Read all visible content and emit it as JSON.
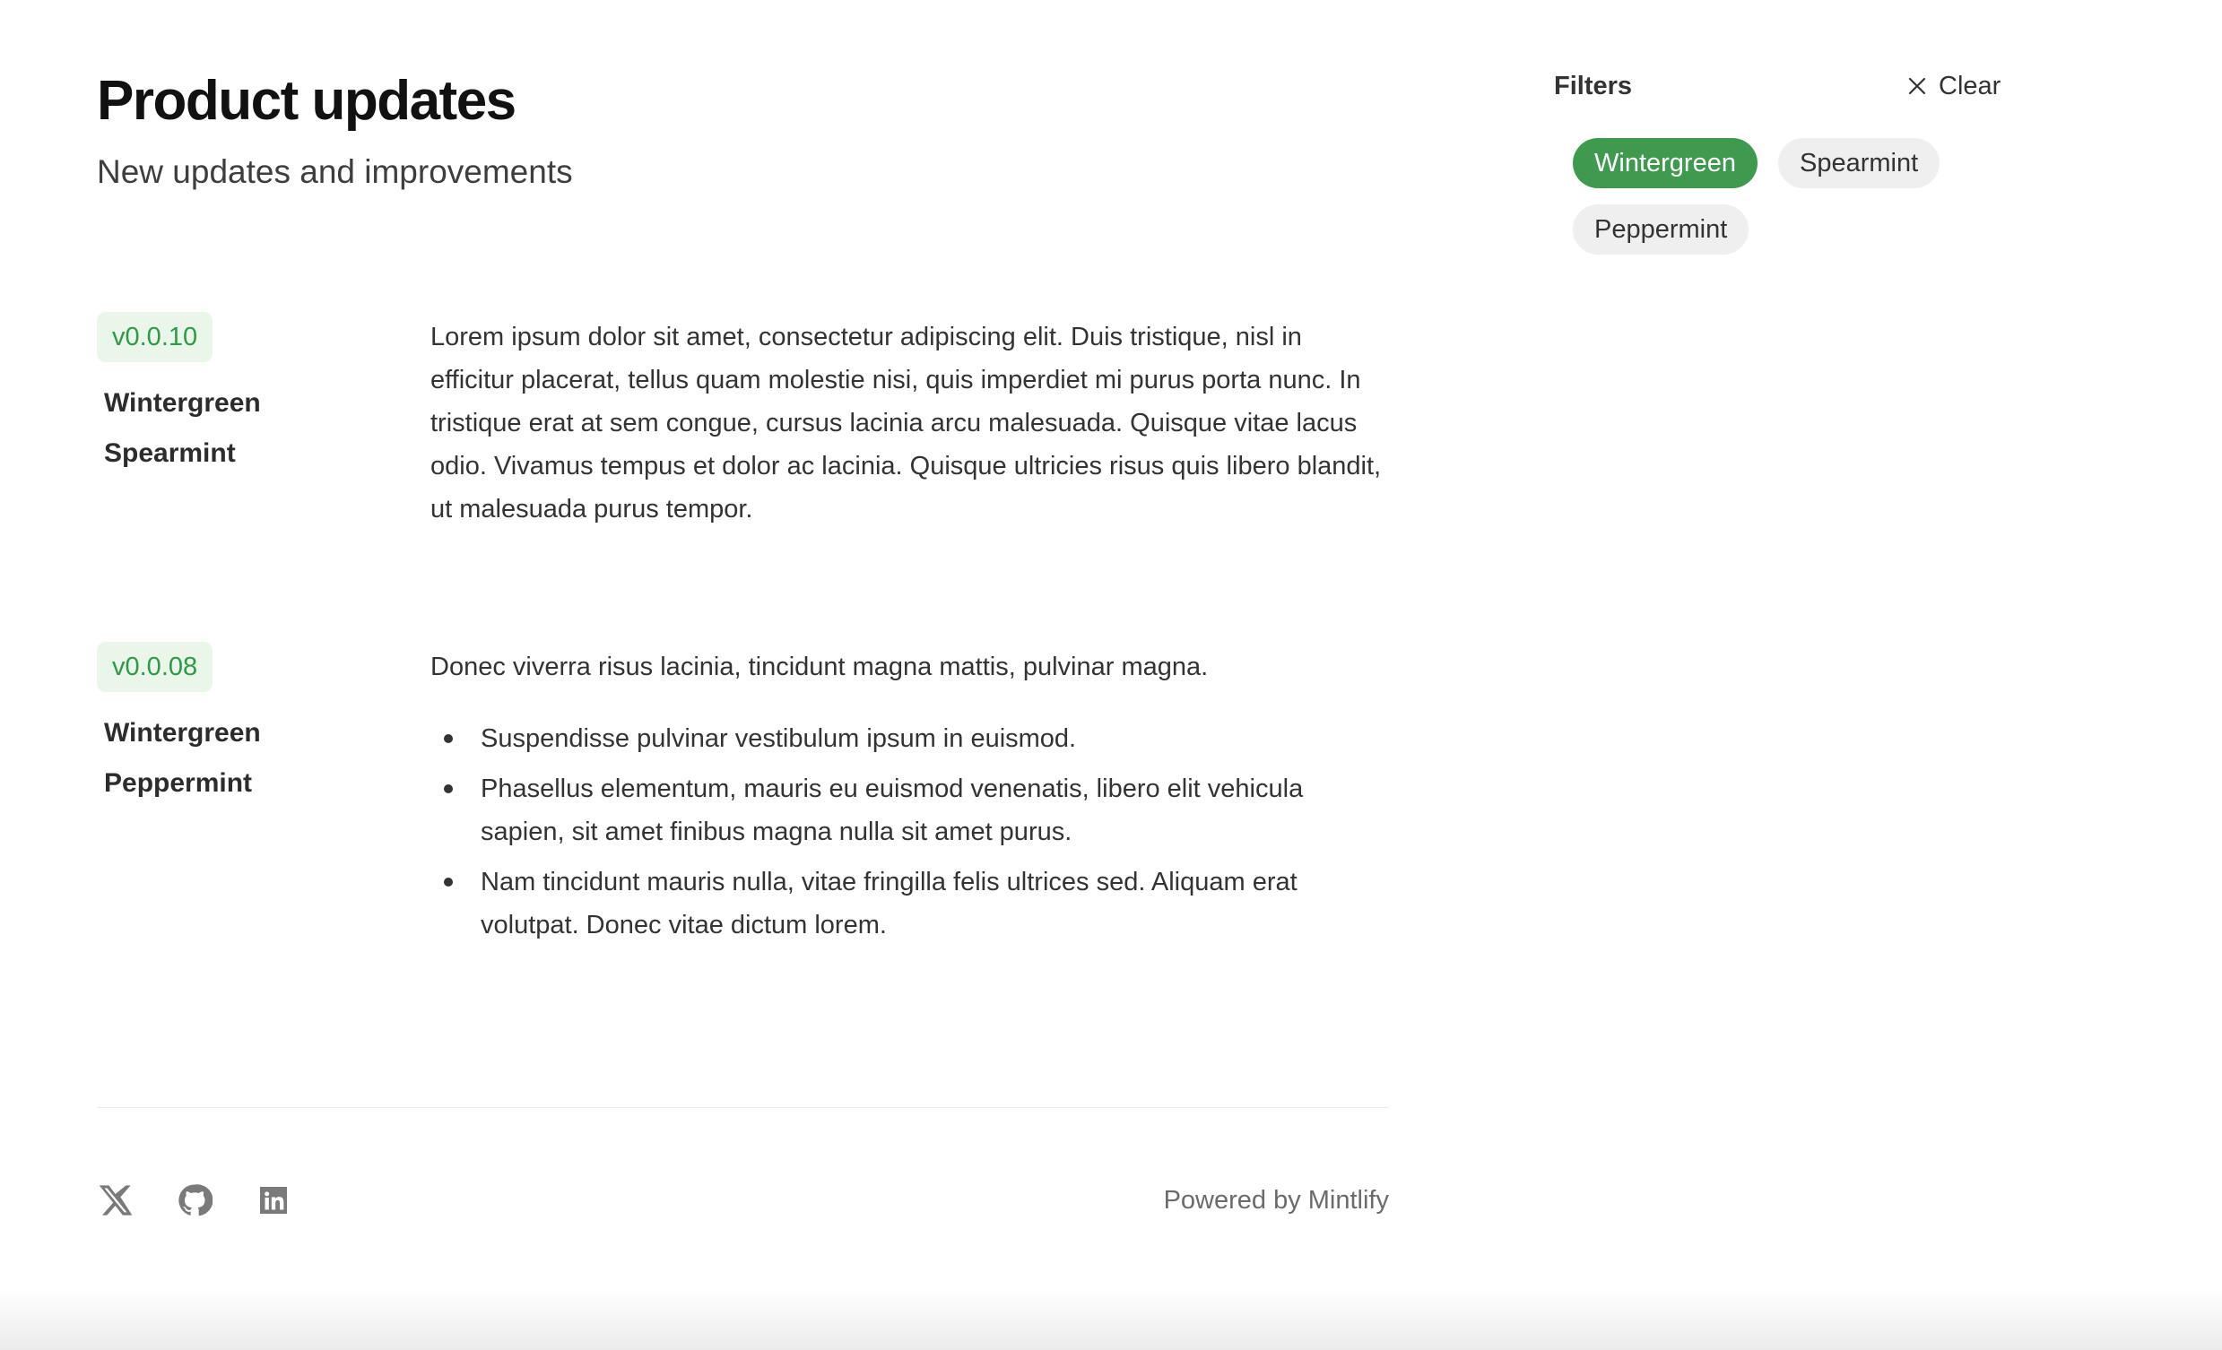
{
  "header": {
    "title": "Product updates",
    "subtitle": "New updates and improvements"
  },
  "entries": [
    {
      "version": "v0.0.10",
      "tags": [
        "Wintergreen",
        "Spearmint"
      ],
      "paragraph": "Lorem ipsum dolor sit amet, consectetur adipiscing elit. Duis tristique, nisl in efficitur placerat, tellus quam molestie nisi, quis imperdiet mi purus porta nunc. In tristique erat at sem congue, cursus lacinia arcu malesuada. Quisque vitae lacus odio. Vivamus tempus et dolor ac lacinia. Quisque ultricies risus quis libero blandit, ut malesuada purus tempor."
    },
    {
      "version": "v0.0.08",
      "tags": [
        "Wintergreen",
        "Peppermint"
      ],
      "paragraph": "Donec viverra risus lacinia, tincidunt magna mattis, pulvinar magna.",
      "bullets": [
        "Suspendisse pulvinar vestibulum ipsum in euismod.",
        "Phasellus elementum, mauris eu euismod venenatis, libero elit vehicula sapien, sit amet finibus magna nulla sit amet purus.",
        "Nam tincidunt mauris nulla, vitae fringilla felis ultrices sed. Aliquam erat volutpat. Donec vitae dictum lorem."
      ]
    }
  ],
  "filters": {
    "label": "Filters",
    "clear_label": "Clear",
    "chips": [
      {
        "label": "Wintergreen",
        "active": true
      },
      {
        "label": "Spearmint",
        "active": false
      },
      {
        "label": "Peppermint",
        "active": false
      }
    ]
  },
  "footer": {
    "social_icons": [
      "x-icon",
      "github-icon",
      "linkedin-icon"
    ],
    "powered_by": "Powered by Mintlify"
  },
  "colors": {
    "accent_green": "#3f9a4f",
    "badge_bg": "#eaf6ea",
    "badge_text": "#2e9a46",
    "chip_inactive_bg": "#efefef"
  }
}
